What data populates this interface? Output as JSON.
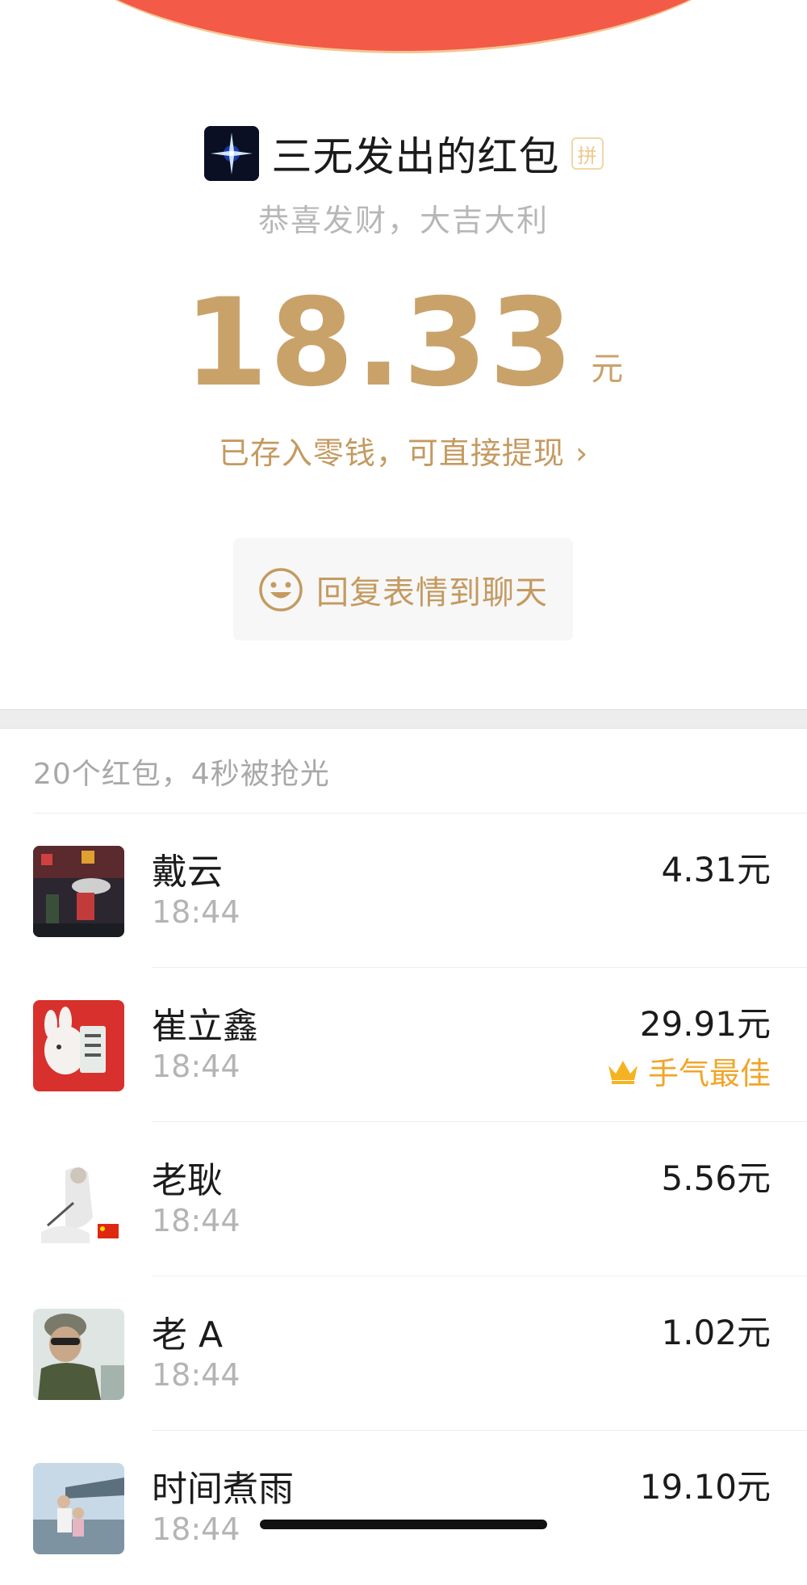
{
  "header": {
    "sender_title": "三无发出的红包",
    "pin_badge": "拼",
    "greeting": "恭喜发财，大吉大利",
    "amount": "18.33",
    "amount_unit": "元",
    "deposit_link": "已存入零钱，可直接提现 ›",
    "reply_button": "回复表情到聊天"
  },
  "summary": "20个红包，4秒被抢光",
  "records": [
    {
      "name": "戴云",
      "time": "18:44",
      "amount": "4.31元",
      "best": ""
    },
    {
      "name": "崔立鑫",
      "time": "18:44",
      "amount": "29.91元",
      "best": "手气最佳"
    },
    {
      "name": "老耿",
      "time": "18:44",
      "amount": "5.56元",
      "best": ""
    },
    {
      "name": "老 A",
      "time": "18:44",
      "amount": "1.02元",
      "best": ""
    },
    {
      "name": "时间煮雨",
      "time": "18:44",
      "amount": "19.10元",
      "best": ""
    }
  ],
  "colors": {
    "red_envelope": "#f45a48",
    "gold": "#c9a26a",
    "best_luck": "#f1a52a"
  },
  "icons": [
    "sender-avatar",
    "smile-icon",
    "crown-icon",
    "chevron-right-icon"
  ]
}
